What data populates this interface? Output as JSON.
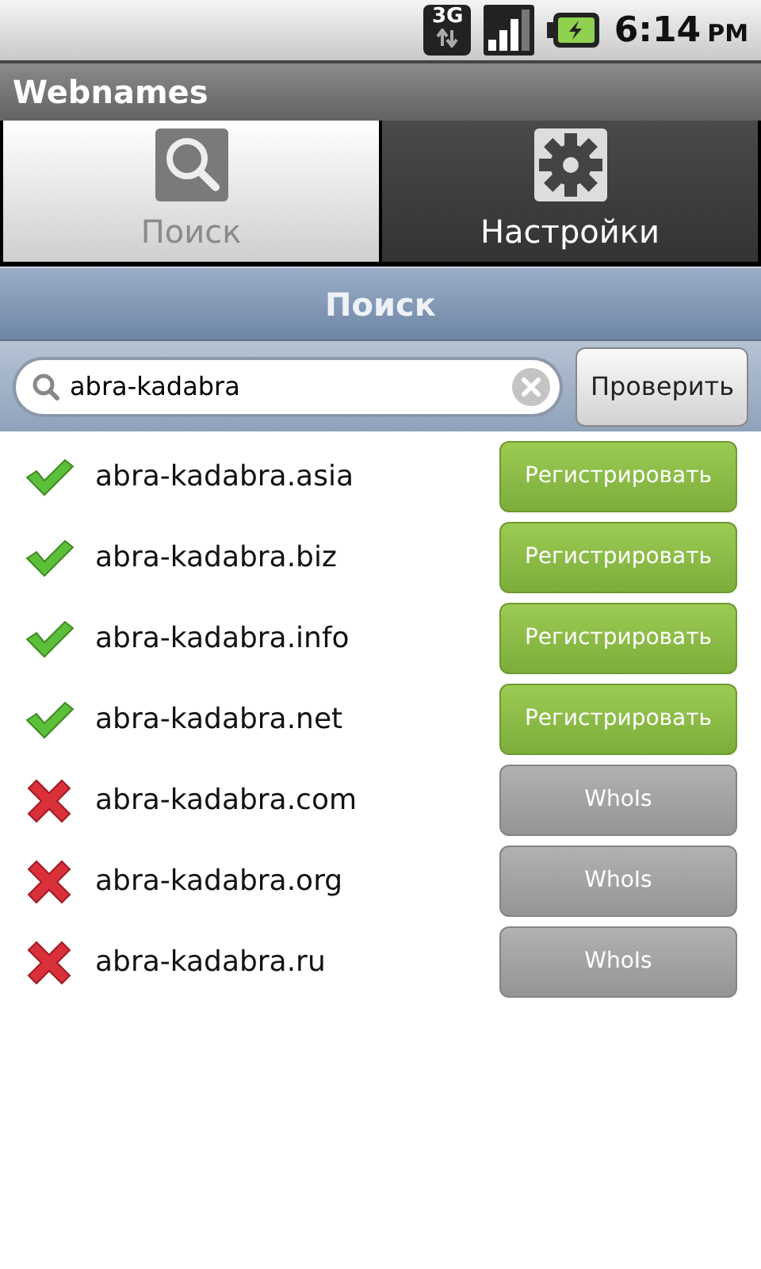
{
  "status_bar": {
    "network": "3G",
    "time": "6:14",
    "period": "PM"
  },
  "app_title": "Webnames",
  "tabs": [
    {
      "label": "Поиск",
      "kind": "search",
      "selected": true
    },
    {
      "label": "Настройки",
      "kind": "settings",
      "selected": false
    }
  ],
  "section_header": "Поиск",
  "search": {
    "value": "abra-kadabra",
    "button": "Проверить"
  },
  "results": [
    {
      "domain": "abra-kadabra.asia",
      "available": true,
      "action": "Регистрировать"
    },
    {
      "domain": "abra-kadabra.biz",
      "available": true,
      "action": "Регистрировать"
    },
    {
      "domain": "abra-kadabra.info",
      "available": true,
      "action": "Регистрировать"
    },
    {
      "domain": "abra-kadabra.net",
      "available": true,
      "action": "Регистрировать"
    },
    {
      "domain": "abra-kadabra.com",
      "available": false,
      "action": "WhoIs"
    },
    {
      "domain": "abra-kadabra.org",
      "available": false,
      "action": "WhoIs"
    },
    {
      "domain": "abra-kadabra.ru",
      "available": false,
      "action": "WhoIs"
    }
  ]
}
